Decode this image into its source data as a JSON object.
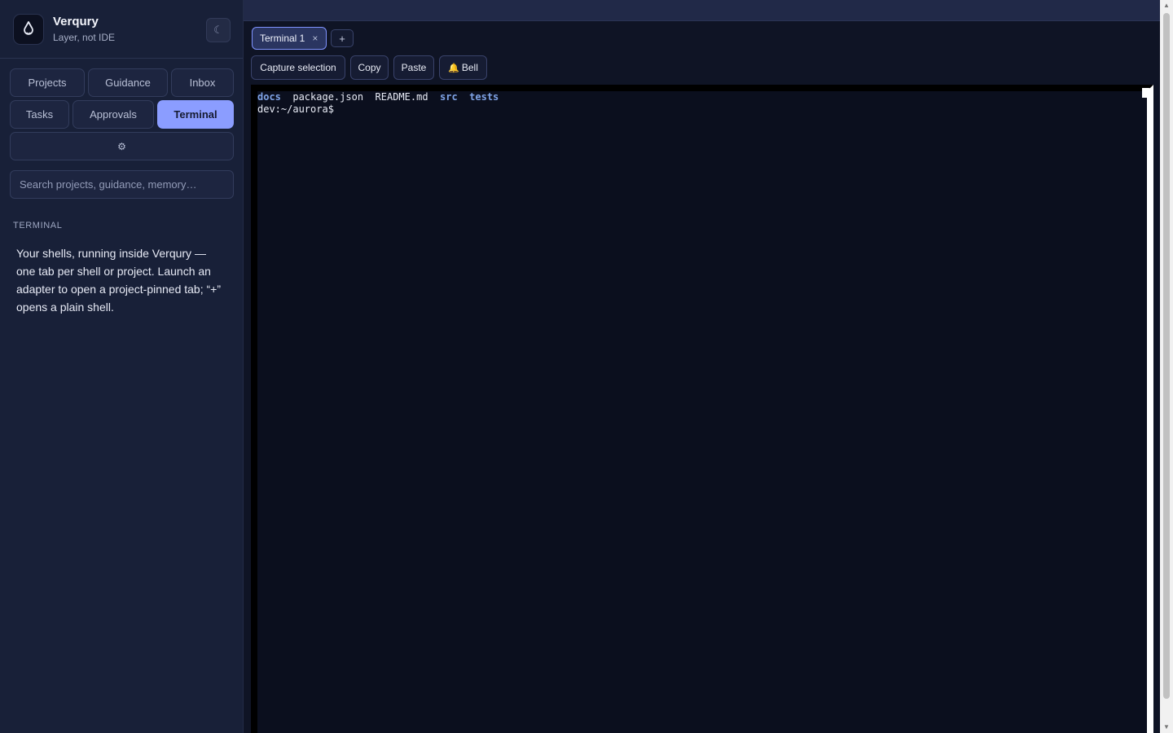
{
  "app": {
    "name": "Verqury",
    "tagline": "Layer, not IDE",
    "theme_toggle_icon": "☾"
  },
  "nav": {
    "projects": "Projects",
    "guidance": "Guidance",
    "inbox": "Inbox",
    "tasks": "Tasks",
    "approvals": "Approvals",
    "terminal": "Terminal",
    "settings_icon": "⚙"
  },
  "search": {
    "placeholder": "Search projects, guidance, memory…"
  },
  "sidebar_section": {
    "title": "TERMINAL",
    "description": "Your shells, running inside Verqury — one tab per shell or project. Launch an adapter to open a project-pinned tab; “+” opens a plain shell."
  },
  "tabs": {
    "active_label": "Terminal 1",
    "close_icon": "×",
    "add_icon": "+"
  },
  "toolbar": {
    "capture": "Capture selection",
    "copy": "Copy",
    "paste": "Paste",
    "bell_icon": "🔔",
    "bell": "Bell"
  },
  "terminal": {
    "listing": {
      "docs": "docs",
      "package": "package.json",
      "readme": "README.md",
      "src": "src",
      "tests": "tests"
    },
    "prompt": "dev:~/aurora$"
  },
  "colors": {
    "accent": "#8b9dff",
    "sidebar_bg": "#182038",
    "main_bg": "#0f1425",
    "terminal_bg": "#0b0f1e",
    "dir_color": "#7fa3e6"
  }
}
